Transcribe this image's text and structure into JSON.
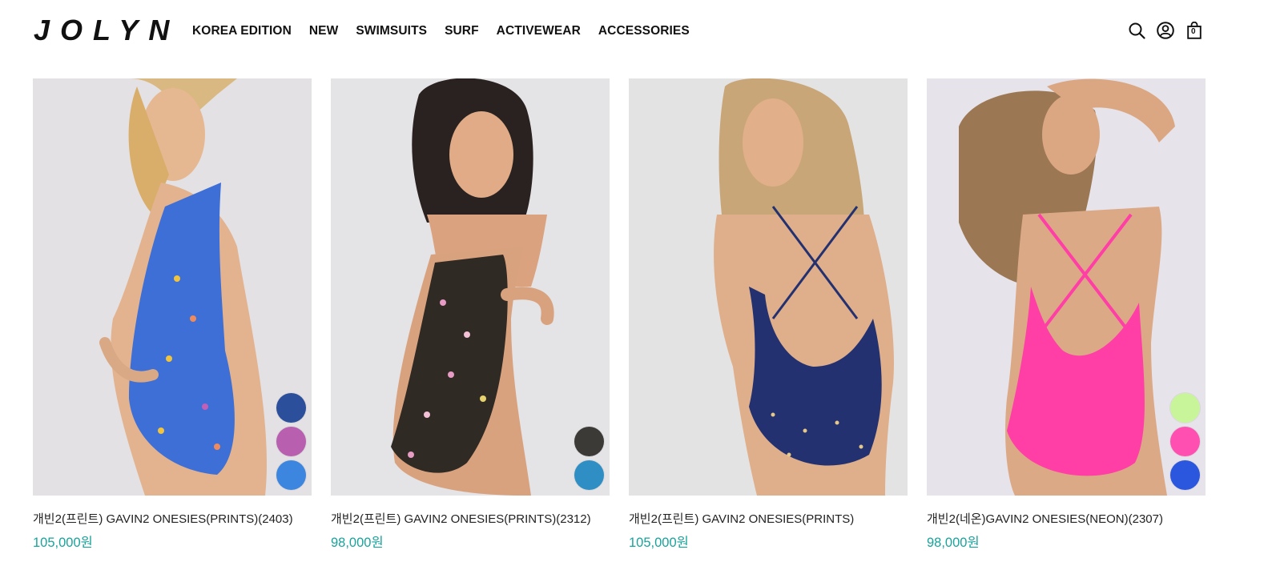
{
  "brand": {
    "logo": "JOLYN"
  },
  "nav": {
    "items": [
      "KOREA EDITION",
      "NEW",
      "SWIMSUITS",
      "SURF",
      "ACTIVEWEAR",
      "ACCESSORIES"
    ]
  },
  "header_icons": [
    "search-icon",
    "account-icon",
    "cart-icon"
  ],
  "cart": {
    "count": "0"
  },
  "colors": {
    "price": "#1aa39b",
    "text": "#111111"
  },
  "products": [
    {
      "name": "개빈2(프린트) GAVIN2 ONESIES(PRINTS)(2403)",
      "price": "105,000원",
      "swatches": [
        "#2b4f9a",
        "#b85fb0",
        "#3d86e0"
      ]
    },
    {
      "name": "개빈2(프린트) GAVIN2 ONESIES(PRINTS)(2312)",
      "price": "98,000원",
      "swatches": [
        "#3b3a36",
        "#2f8fc4"
      ]
    },
    {
      "name": "개빈2(프린트) GAVIN2 ONESIES(PRINTS)",
      "price": "105,000원",
      "swatches": []
    },
    {
      "name": "개빈2(네온)GAVIN2 ONESIES(NEON)(2307)",
      "price": "98,000원",
      "swatches": [
        "#c9f59a",
        "#ff4fb0",
        "#2b56de"
      ]
    }
  ]
}
